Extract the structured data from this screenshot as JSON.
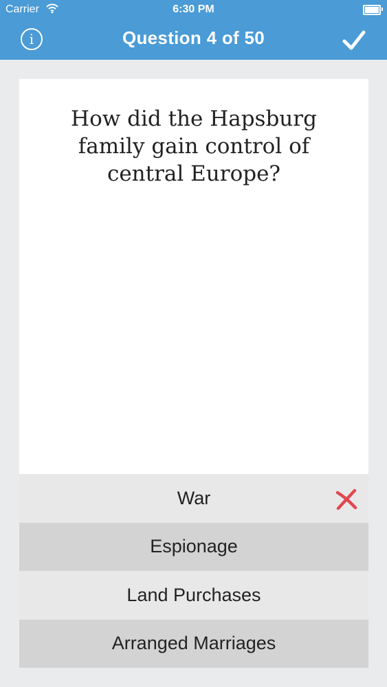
{
  "status_bar": {
    "carrier": "Carrier",
    "time": "6:30 PM",
    "wifi_icon": "wifi-icon",
    "battery_icon": "battery-icon"
  },
  "nav": {
    "title": "Question 4 of 50",
    "info_label": "i",
    "info_icon": "info-icon",
    "confirm_icon": "checkmark-icon"
  },
  "question": {
    "text": "How did the Hapsburg family gain control of central Europe?"
  },
  "answers": [
    {
      "label": "War",
      "state": "incorrect",
      "icon": "x-mark-icon"
    },
    {
      "label": "Espionage"
    },
    {
      "label": "Land Purchases"
    },
    {
      "label": "Arranged Marriages"
    }
  ],
  "colors": {
    "header": "#4a9bd6",
    "background": "#e9ebed",
    "card": "#ffffff",
    "answer_light": "#e8e8e9",
    "answer_dark": "#d3d3d4",
    "incorrect_mark": "#e2474f"
  }
}
